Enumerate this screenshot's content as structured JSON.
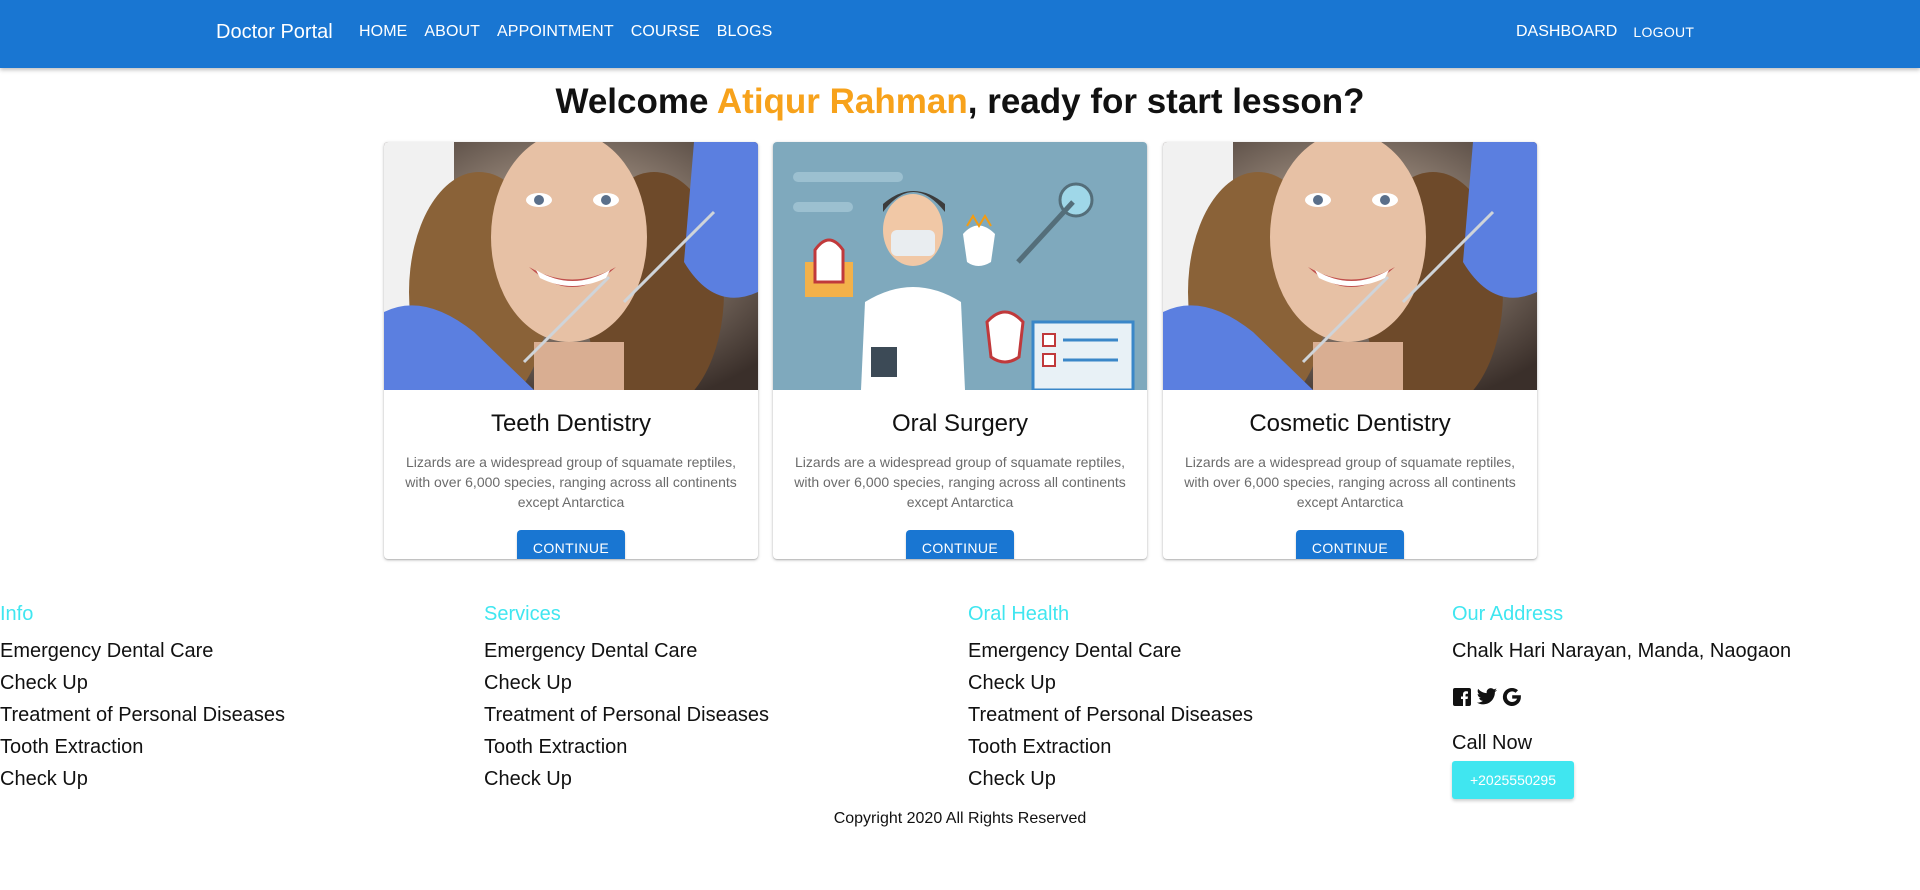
{
  "navbar": {
    "brand": "Doctor Portal",
    "links": [
      "HOME",
      "ABOUT",
      "APPOINTMENT",
      "COURSE",
      "BLOGS"
    ],
    "dashboard": "DASHBOARD",
    "logout": "LOGOUT",
    "color": "#1976d2"
  },
  "welcome": {
    "prefix": "Welcome ",
    "name": "Atiqur Rahman",
    "suffix": ", ready for start lesson?",
    "name_color": "#f7a21b"
  },
  "cards": [
    {
      "image": "smiling-woman-dentist-photo",
      "title": "Teeth Dentistry",
      "text": "Lizards are a widespread group of squamate reptiles, with over 6,000 species, ranging across all continents except Antarctica",
      "button": "CONTINUE"
    },
    {
      "image": "dentist-illustration",
      "title": "Oral Surgery",
      "text": "Lizards are a widespread group of squamate reptiles, with over 6,000 species, ranging across all continents except Antarctica",
      "button": "CONTINUE"
    },
    {
      "image": "smiling-woman-dentist-photo",
      "title": "Cosmetic Dentistry",
      "text": "Lizards are a widespread group of squamate reptiles, with over 6,000 species, ranging across all continents except Antarctica",
      "button": "CONTINUE"
    }
  ],
  "footer": {
    "info": {
      "title": "Info",
      "items": [
        "Emergency Dental Care",
        "Check Up",
        "Treatment of Personal Diseases",
        "Tooth Extraction",
        "Check Up"
      ]
    },
    "services": {
      "title": "Services",
      "items": [
        "Emergency Dental Care",
        "Check Up",
        "Treatment of Personal Diseases",
        "Tooth Extraction",
        "Check Up"
      ]
    },
    "oral_health": {
      "title": "Oral Health",
      "items": [
        "Emergency Dental Care",
        "Check Up",
        "Treatment of Personal Diseases",
        "Tooth Extraction",
        "Check Up"
      ]
    },
    "address": {
      "title": "Our Address",
      "text": "Chalk Hari Narayan, Manda, Naogaon",
      "socials": [
        "facebook-icon",
        "twitter-icon",
        "google-icon"
      ],
      "call_label": "Call Now",
      "phone": "+2025550295"
    },
    "heading_color": "#40e6f0",
    "copyright": "Copyright 2020 All Rights Reserved"
  }
}
